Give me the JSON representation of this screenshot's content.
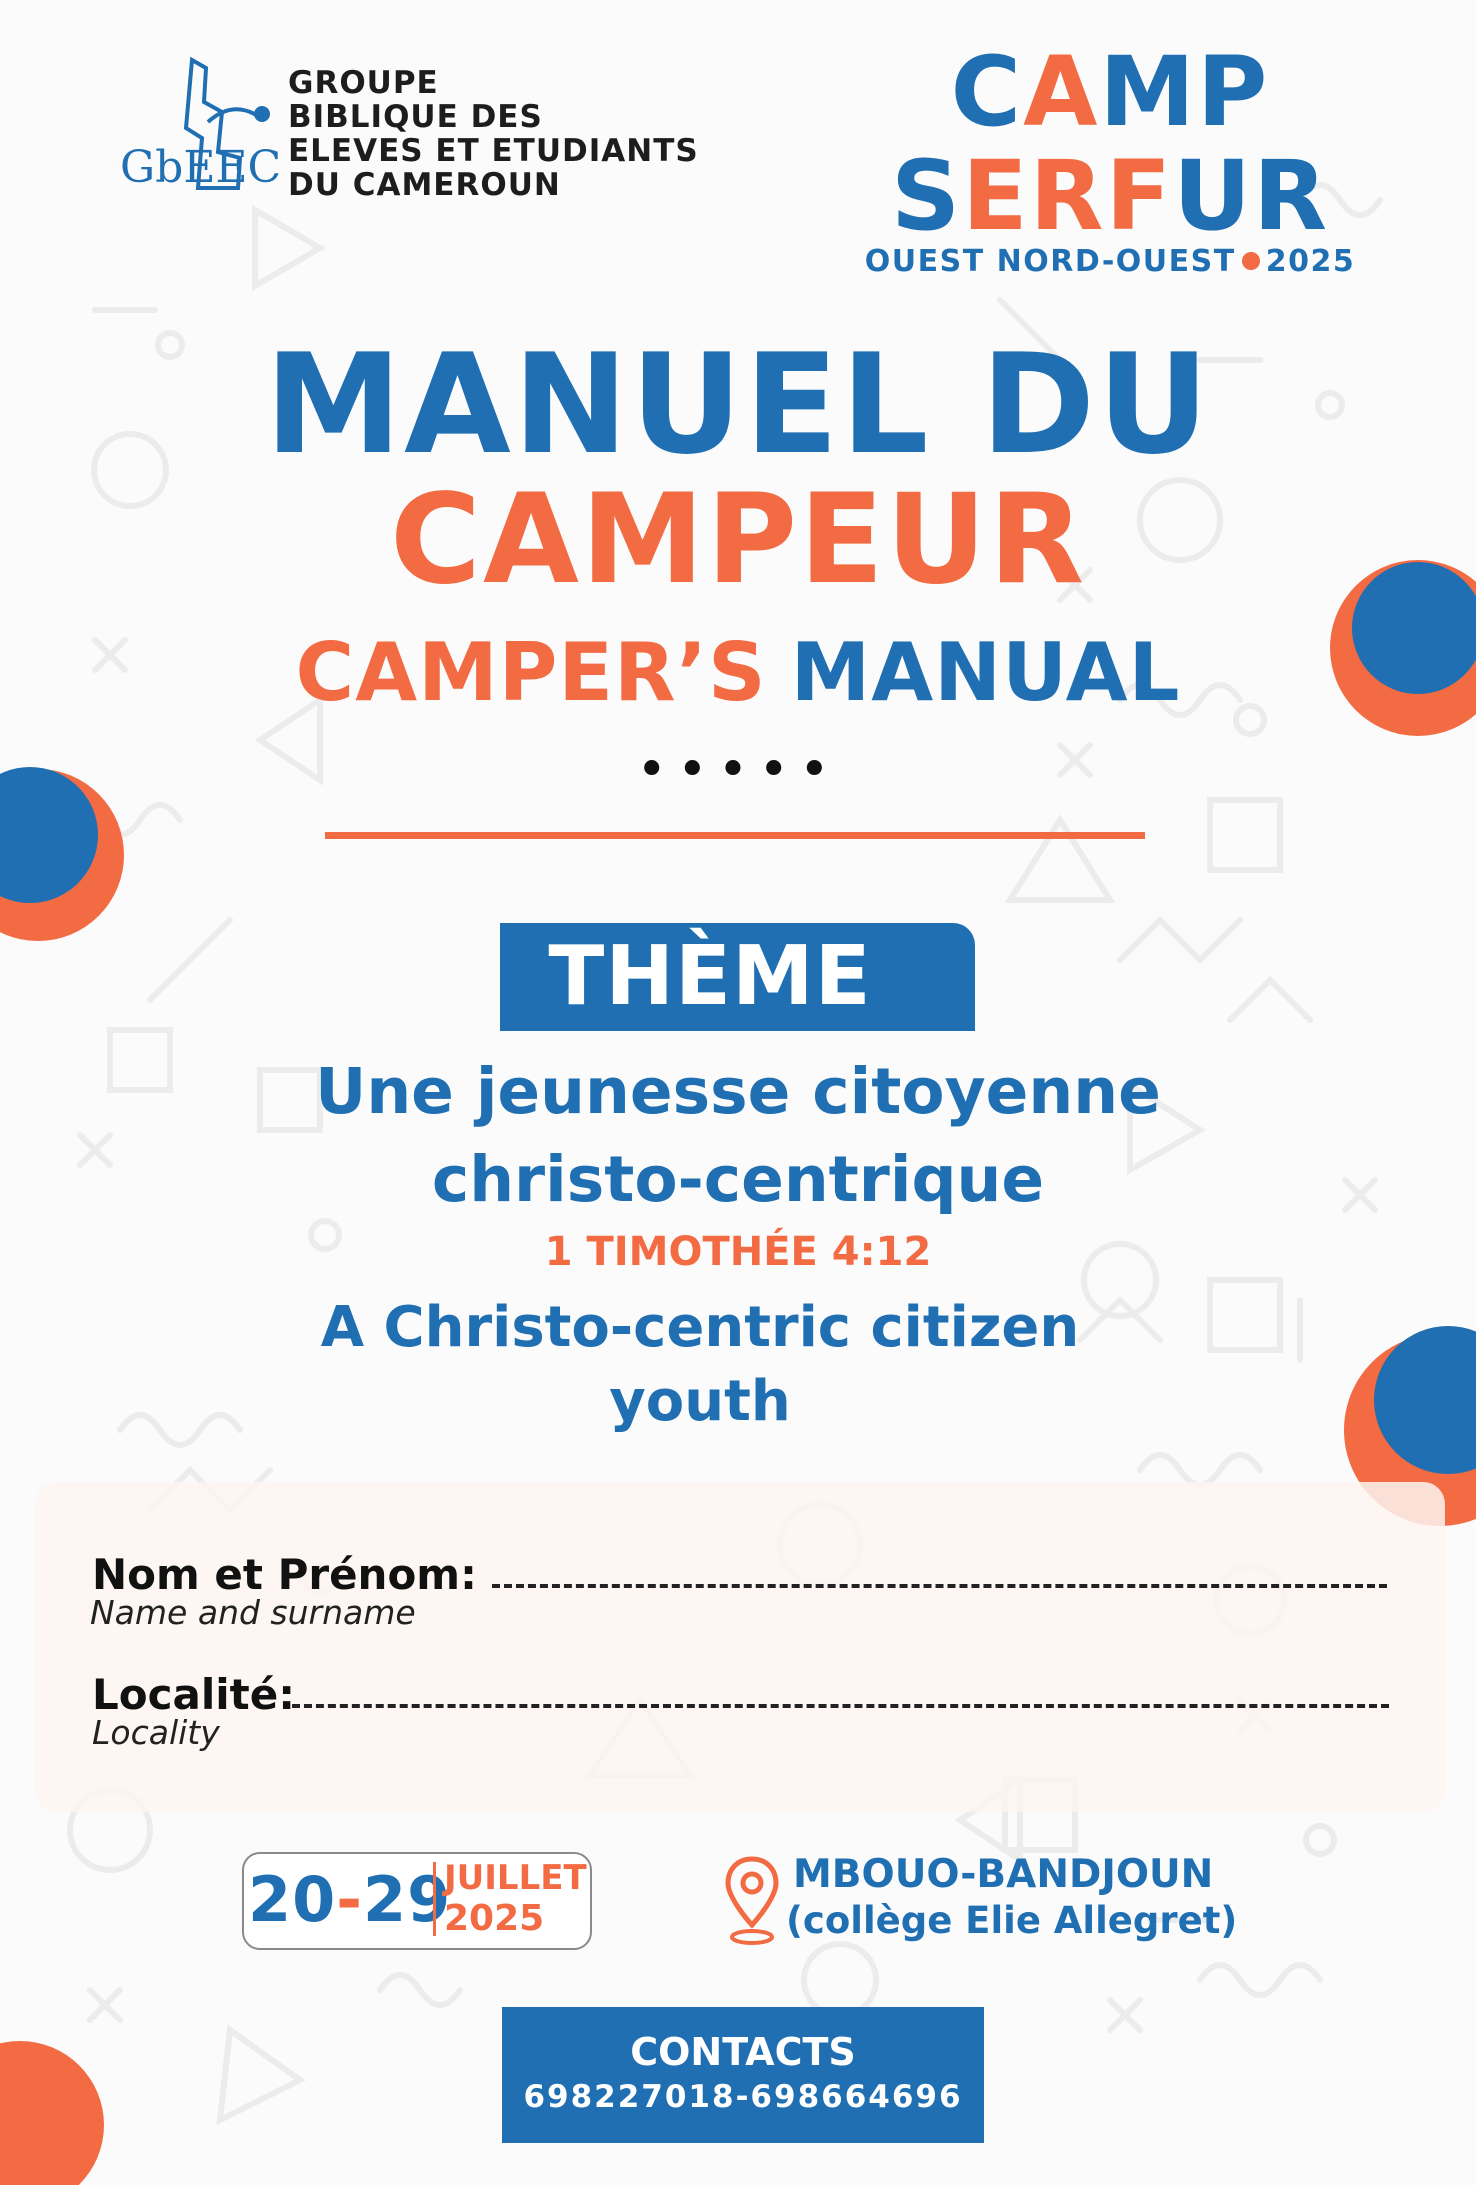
{
  "org": {
    "logo_text": "GbEEC",
    "name_lines": [
      "GROUPE",
      "BIBLIQUE DES",
      "ELEVES ET ETUDIANTS",
      "DU CAMEROUN"
    ]
  },
  "camp": {
    "line1": {
      "a": "C",
      "b": "A",
      "c": "MP"
    },
    "line2": {
      "a": "S",
      "b": "ERF",
      "c": "U",
      "d": "R"
    },
    "region": "OUEST  NORD-OUEST",
    "year": "2025"
  },
  "title": {
    "line1": "MANUEL DU",
    "line2": "CAMPEUR",
    "en_part1": "CAMPER’S",
    "en_part2": "MANUAL",
    "dots": "•••••"
  },
  "theme": {
    "label": "THÈME",
    "fr_line1": "Une jeunesse citoyenne",
    "fr_line2": "christo-centrique",
    "verse": "1 TIMOTHÉE 4:12",
    "en_line1": "A Christo-centric citizen",
    "en_line2": "youth"
  },
  "form": {
    "name_label": "Nom et Prénom:",
    "name_sub": "Name and surname",
    "locality_label": "Localité:",
    "locality_sub": "Locality"
  },
  "dates": {
    "start": "20",
    "dash": "-",
    "end": "29",
    "month": "JUILLET",
    "year": "2025"
  },
  "location": {
    "line1": "MBOUO-BANDJOUN",
    "line2": "(collège Elie Allegret)"
  },
  "contacts": {
    "label": "CONTACTS",
    "numbers": "698227018-698664696"
  },
  "colors": {
    "blue": "#1f6fb2",
    "orange": "#f26b43",
    "dark": "#1d1d1b"
  }
}
